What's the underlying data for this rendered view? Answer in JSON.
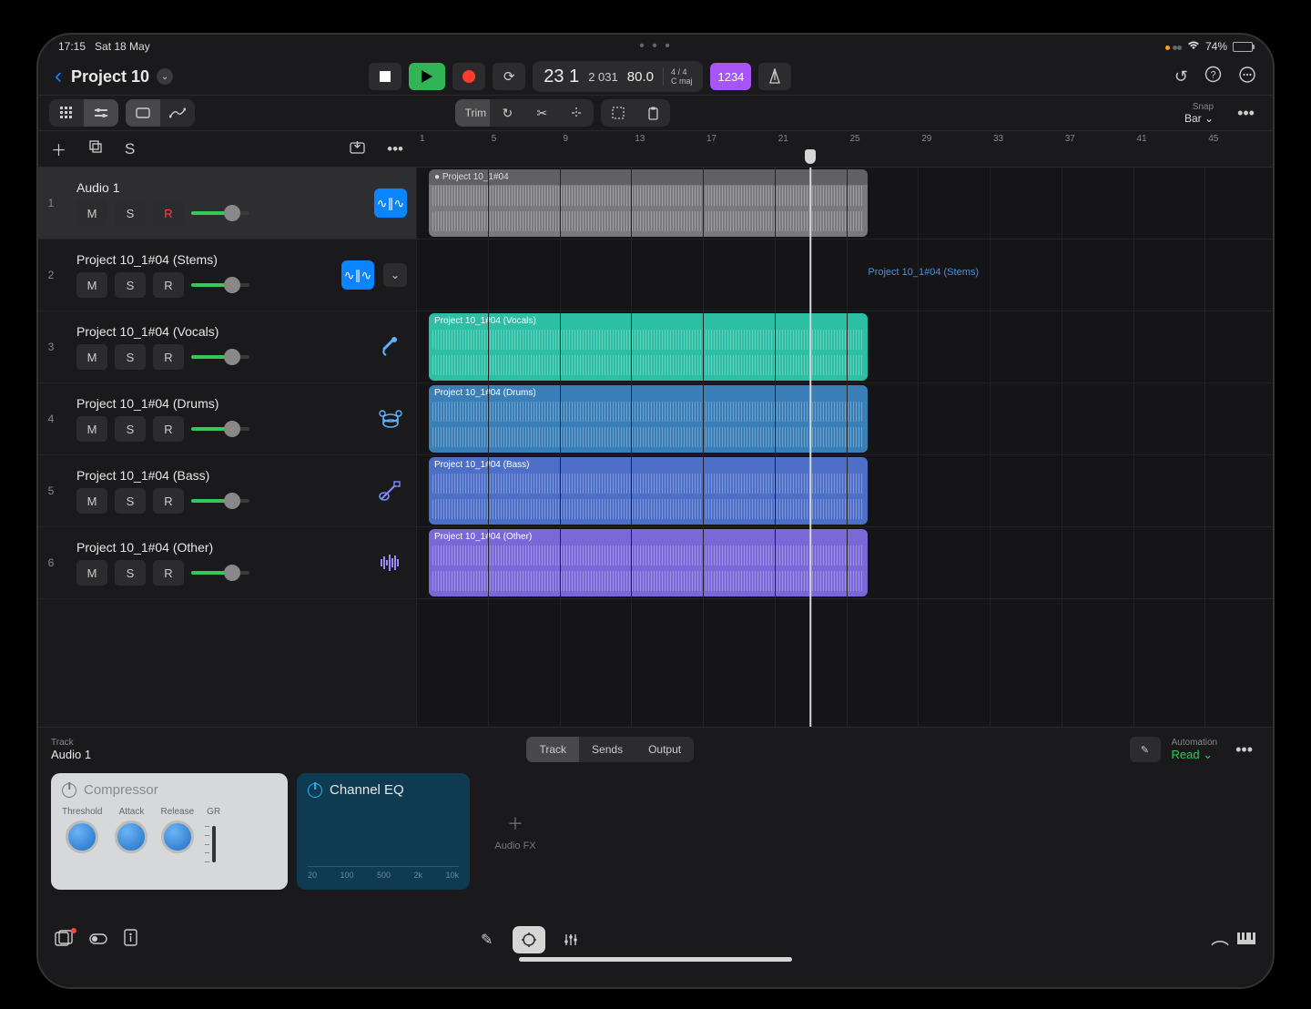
{
  "status": {
    "time": "17:15",
    "date": "Sat 18 May",
    "battery_pct": "74%"
  },
  "header": {
    "project_title": "Project 10",
    "lcd": {
      "bars": "23 1",
      "beats": "2 031",
      "tempo": "80.0",
      "sig_top": "4 / 4",
      "sig_bot": "C maj"
    },
    "count_in": "1234"
  },
  "toolbar": {
    "trim_label": "Trim",
    "snap_label": "Snap",
    "snap_value": "Bar"
  },
  "ruler_ticks": [
    "1",
    "5",
    "9",
    "13",
    "17",
    "21",
    "25",
    "29",
    "33",
    "37",
    "41",
    "45"
  ],
  "playhead_bar": 23,
  "region_start_bar": 1,
  "region_end_bar": 25.5,
  "tracks": [
    {
      "num": "1",
      "name": "Audio 1",
      "record_armed": true,
      "selected": true,
      "vol": 70,
      "icon": "wave",
      "region": {
        "label": "Project 10_1#04",
        "cls": "audio1"
      }
    },
    {
      "num": "2",
      "name": "Project 10_1#04 (Stems)",
      "vol": 70,
      "icon": "wave",
      "has_expand": true,
      "stems_text": "Project 10_1#04 (Stems)"
    },
    {
      "num": "3",
      "name": "Project 10_1#04 (Vocals)",
      "vol": 70,
      "icon": "mic",
      "region": {
        "label": "Project 10_1#04 (Vocals)",
        "cls": "vocals"
      }
    },
    {
      "num": "4",
      "name": "Project 10_1#04 (Drums)",
      "vol": 70,
      "icon": "drums",
      "region": {
        "label": "Project 10_1#04 (Drums)",
        "cls": "drums"
      }
    },
    {
      "num": "5",
      "name": "Project 10_1#04 (Bass)",
      "vol": 70,
      "icon": "bass",
      "region": {
        "label": "Project 10_1#04 (Bass)",
        "cls": "bass"
      }
    },
    {
      "num": "6",
      "name": "Project 10_1#04 (Other)",
      "vol": 70,
      "icon": "other",
      "region": {
        "label": "Project 10_1#04 (Other)",
        "cls": "other"
      }
    }
  ],
  "inspector": {
    "track_label": "Track",
    "track_name": "Audio 1",
    "tabs": [
      "Track",
      "Sends",
      "Output"
    ],
    "automation_label": "Automation",
    "automation_value": "Read",
    "compressor": {
      "title": "Compressor",
      "knobs": [
        "Threshold",
        "Attack",
        "Release"
      ],
      "gr": "GR"
    },
    "eq": {
      "title": "Channel EQ",
      "ticks": [
        "20",
        "100",
        "500",
        "2k",
        "10k"
      ]
    },
    "add_fx": "Audio FX"
  }
}
